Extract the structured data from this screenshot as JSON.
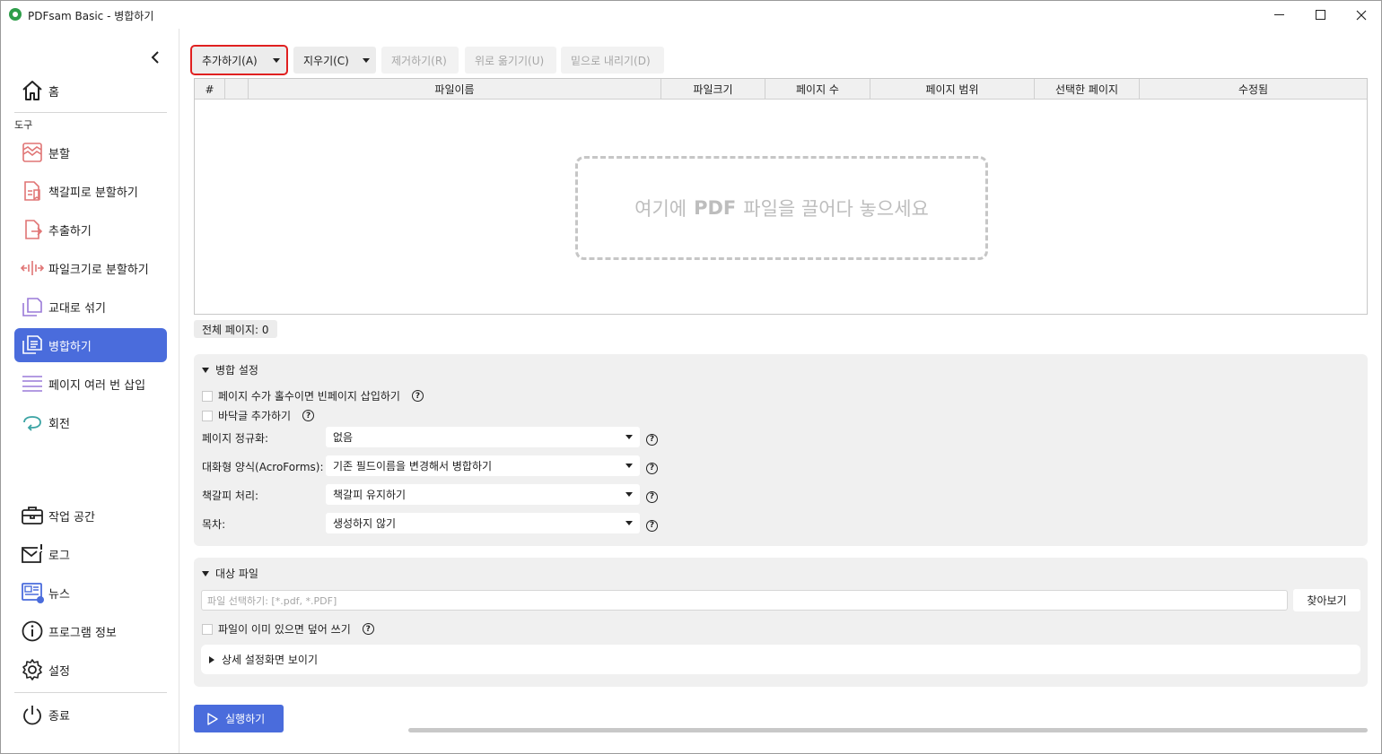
{
  "window": {
    "title": "PDFsam Basic - 병합하기"
  },
  "sidebar": {
    "home": "홈",
    "tools_section": "도구",
    "tools": [
      {
        "label": "분할",
        "icon": "split-icon"
      },
      {
        "label": "책갈피로 분할하기",
        "icon": "split-by-bookmarks-icon"
      },
      {
        "label": "추출하기",
        "icon": "extract-icon"
      },
      {
        "label": "파일크기로 분할하기",
        "icon": "split-by-size-icon"
      },
      {
        "label": "교대로 섞기",
        "icon": "alternate-mix-icon"
      },
      {
        "label": "병합하기",
        "icon": "merge-icon",
        "active": true
      },
      {
        "label": "페이지 여러 번 삽입",
        "icon": "insert-pages-icon"
      },
      {
        "label": "회전",
        "icon": "rotate-icon"
      }
    ],
    "bottom": [
      {
        "label": "작업 공간",
        "icon": "workspace-icon"
      },
      {
        "label": "로그",
        "icon": "log-icon"
      },
      {
        "label": "뉴스",
        "icon": "news-icon"
      },
      {
        "label": "프로그램 정보",
        "icon": "info-icon"
      },
      {
        "label": "설정",
        "icon": "gear-icon"
      }
    ],
    "exit": "종료"
  },
  "toolbar": {
    "add": "추가하기(A)",
    "clear": "지우기(C)",
    "remove": "제거하기(R)",
    "move_up": "위로 옮기기(U)",
    "move_down": "밑으로 내리기(D)"
  },
  "table": {
    "columns": [
      "#",
      "",
      "파일이름",
      "파일크기",
      "페이지 수",
      "페이지 범위",
      "선택한 페이지",
      "수정됨"
    ],
    "rows": [],
    "dropzone_pre": "여기에",
    "dropzone_bold": "PDF",
    "dropzone_post": "파일을 끌어다 놓으세요"
  },
  "total_pages": "전체 페이지: 0",
  "merge_settings": {
    "title": "병합 설정",
    "blank_page_checkbox": "페이지 수가 홀수이면 빈페이지 삽입하기",
    "footer_checkbox": "바닥글 추가하기",
    "normalize_label": "페이지 정규화:",
    "normalize_value": "없음",
    "acroforms_label": "대화형 양식(AcroForms):",
    "acroforms_value": "기존 필드이름을 변경해서 병합하기",
    "bookmarks_label": "책갈피 처리:",
    "bookmarks_value": "책갈피 유지하기",
    "toc_label": "목차:",
    "toc_value": "생성하지 않기"
  },
  "destination": {
    "title": "대상 파일",
    "input_placeholder": "파일 선택하기: [*.pdf, *.PDF]",
    "browse": "찾아보기",
    "overwrite_checkbox": "파일이 이미 있으면 덮어 쓰기",
    "advanced": "상세 설정화면 보이기"
  },
  "run_button": "실행하기",
  "colors": {
    "accent": "#4a6cdc",
    "highlight": "#e02020",
    "panel_bg": "#f0f0f0"
  }
}
